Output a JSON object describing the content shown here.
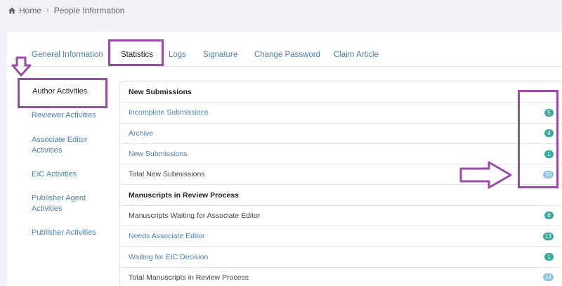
{
  "breadcrumb": {
    "home": "Home",
    "current": "People Information"
  },
  "tabs": [
    {
      "label": "General Information"
    },
    {
      "label": "Statistics"
    },
    {
      "label": "Logs"
    },
    {
      "label": "Signature"
    },
    {
      "label": "Change Password"
    },
    {
      "label": "Claim Article"
    }
  ],
  "sidebar": [
    {
      "label": "Author Activities"
    },
    {
      "label": "Reviewer Activities"
    },
    {
      "label": "Associate Editor Activities"
    },
    {
      "label": "EIC Activities"
    },
    {
      "label": "Publisher Agent Activities"
    },
    {
      "label": "Publisher Activities"
    }
  ],
  "rows": [
    {
      "label": "New Submissions",
      "count": ""
    },
    {
      "label": "Incomplete Submissions",
      "count": "5"
    },
    {
      "label": "Archive",
      "count": "4"
    },
    {
      "label": "New Submissions",
      "count": "1"
    },
    {
      "label": "Total New Submissions",
      "count": "10"
    },
    {
      "label": "Manuscripts in Review Process",
      "count": ""
    },
    {
      "label": "Manuscripts Waiting for Associate Editor",
      "count": "0"
    },
    {
      "label": "Needs Associate Editor",
      "count": "13"
    },
    {
      "label": "Waiting for EIC Decision",
      "count": "1"
    },
    {
      "label": "Total Manuscripts in Review Process",
      "count": "14"
    }
  ],
  "colors": {
    "badge_teal": "#3aa99f",
    "badge_total": "#8fc4ec",
    "annotation": "#9b4aa8",
    "link": "#4a7fb5"
  }
}
